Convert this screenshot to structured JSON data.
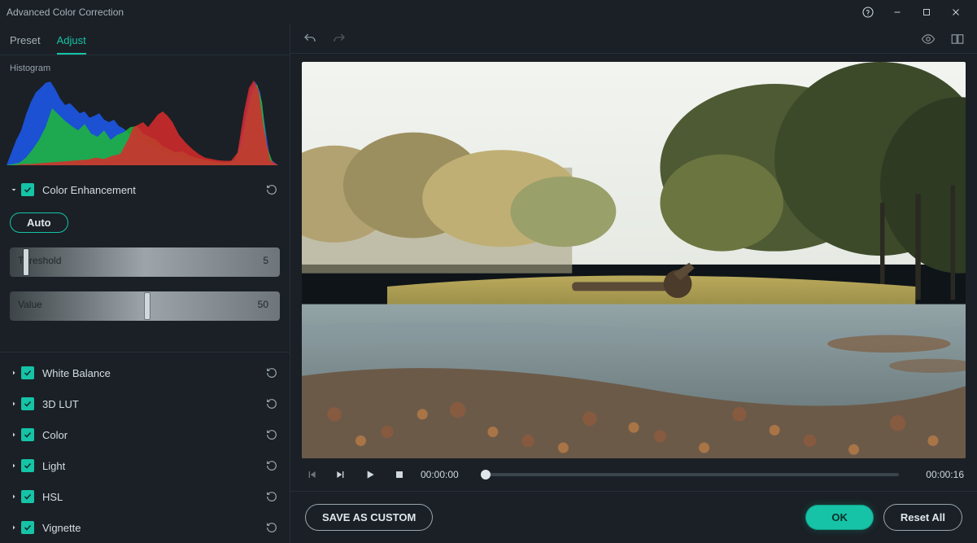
{
  "window": {
    "title": "Advanced Color Correction"
  },
  "tabs": {
    "preset": "Preset",
    "adjust": "Adjust"
  },
  "histogram": {
    "label": "Histogram"
  },
  "enhance": {
    "title": "Color Enhancement",
    "auto": "Auto",
    "threshold": {
      "label": "Threshold",
      "value": "5",
      "pct": 5
    },
    "value": {
      "label": "Value",
      "value": "50",
      "pct": 50
    }
  },
  "sections": {
    "white_balance": "White Balance",
    "lut": "3D LUT",
    "color": "Color",
    "light": "Light",
    "hsl": "HSL",
    "vignette": "Vignette"
  },
  "playback": {
    "current": "00:00:00",
    "total": "00:00:16"
  },
  "footer": {
    "save": "SAVE AS CUSTOM",
    "ok": "OK",
    "reset": "Reset All"
  }
}
